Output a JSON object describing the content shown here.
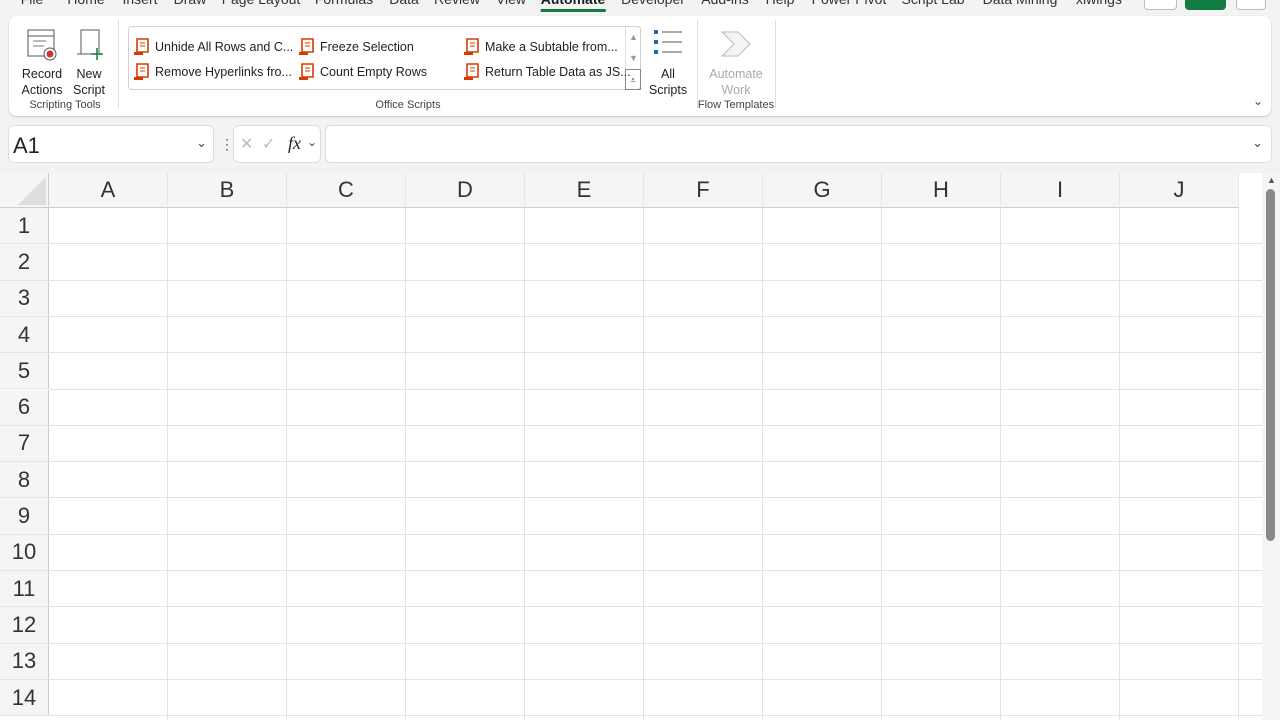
{
  "tabs": [
    "File",
    "Home",
    "Insert",
    "Draw",
    "Page Layout",
    "Formulas",
    "Data",
    "Review",
    "View",
    "Automate",
    "Developer",
    "Add-ins",
    "Help",
    "Power Pivot",
    "Script Lab",
    "Data Mining",
    "xlwings"
  ],
  "active_tab": "Automate",
  "ribbon": {
    "scripting_tools": {
      "label": "Scripting Tools",
      "record": "Record Actions",
      "new_script": "New Script"
    },
    "office_scripts": {
      "label": "Office Scripts",
      "scripts": [
        "Unhide All Rows and C...",
        "Remove Hyperlinks fro...",
        "Freeze Selection",
        "Count Empty Rows",
        "Make a Subtable from...",
        "Return Table Data as JS..."
      ],
      "all_scripts": "All Scripts"
    },
    "flow_templates": {
      "label": "Flow Templates",
      "automate_work": "Automate Work"
    }
  },
  "formula_bar": {
    "name_box": "A1",
    "fx": "fx",
    "formula": ""
  },
  "columns": [
    "A",
    "B",
    "C",
    "D",
    "E",
    "F",
    "G",
    "H",
    "I",
    "J"
  ],
  "rows": [
    "1",
    "2",
    "3",
    "4",
    "5",
    "6",
    "7",
    "8",
    "9",
    "10",
    "11",
    "12",
    "13",
    "14"
  ],
  "colors": {
    "accent": "#107c41",
    "script_icon": "#d83b01"
  }
}
